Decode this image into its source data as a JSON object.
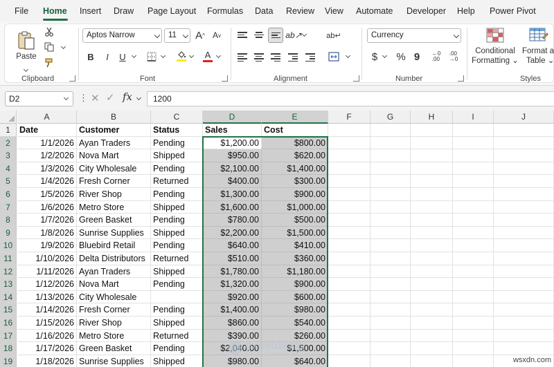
{
  "menu": {
    "tabs": [
      "File",
      "Home",
      "Insert",
      "Draw",
      "Page Layout",
      "Formulas",
      "Data",
      "Review",
      "View",
      "Automate",
      "Developer",
      "Help",
      "Power Pivot"
    ],
    "active": "Home"
  },
  "ribbon": {
    "clipboard": {
      "paste_label": "Paste",
      "group_label": "Clipboard"
    },
    "font": {
      "font_name": "Aptos Narrow",
      "font_size": "11",
      "bold": "B",
      "italic": "I",
      "underline": "U",
      "font_color_glyph": "A",
      "fill_color": "#ffe900",
      "font_color": "#e02020",
      "grow_glyph": "A",
      "shrink_glyph": "A",
      "group_label": "Font"
    },
    "alignment": {
      "group_label": "Alignment"
    },
    "number": {
      "format": "Currency",
      "currency_glyph": "$",
      "percent_glyph": "%",
      "comma_glyph": "9",
      "group_label": "Number"
    },
    "styles": {
      "conditional_formatting_line1": "Conditional",
      "conditional_formatting_line2": "Formatting",
      "format_as_table_line1": "Format as",
      "format_as_table_line2": "Table",
      "group_label": "Styles"
    }
  },
  "formula_bar": {
    "name_box": "D2",
    "fx_label": "fx",
    "value": "1200"
  },
  "sheet": {
    "columns": [
      "A",
      "B",
      "C",
      "D",
      "E",
      "F",
      "G",
      "H",
      "I",
      "J"
    ],
    "selected_columns": [
      "D",
      "E"
    ],
    "selected_range": "D2:E19",
    "active_cell": "D2",
    "headers": [
      "Date",
      "Customer",
      "Status",
      "Sales",
      "Cost"
    ],
    "rows": [
      [
        "1/1/2026",
        "Ayan Traders",
        "Pending",
        "$1,200.00",
        "$800.00"
      ],
      [
        "1/2/2026",
        "Nova Mart",
        "Shipped",
        "$950.00",
        "$620.00"
      ],
      [
        "1/3/2026",
        "City Wholesale",
        "Pending",
        "$2,100.00",
        "$1,400.00"
      ],
      [
        "1/4/2026",
        "Fresh Corner",
        "Returned",
        "$400.00",
        "$300.00"
      ],
      [
        "1/5/2026",
        "River Shop",
        "Pending",
        "$1,300.00",
        "$900.00"
      ],
      [
        "1/6/2026",
        "Metro Store",
        "Shipped",
        "$1,600.00",
        "$1,000.00"
      ],
      [
        "1/7/2026",
        "Green Basket",
        "Pending",
        "$780.00",
        "$500.00"
      ],
      [
        "1/8/2026",
        "Sunrise Supplies",
        "Shipped",
        "$2,200.00",
        "$1,500.00"
      ],
      [
        "1/9/2026",
        "Bluebird Retail",
        "Pending",
        "$640.00",
        "$410.00"
      ],
      [
        "1/10/2026",
        "Delta Distributors",
        "Returned",
        "$510.00",
        "$360.00"
      ],
      [
        "1/11/2026",
        "Ayan Traders",
        "Shipped",
        "$1,780.00",
        "$1,180.00"
      ],
      [
        "1/12/2026",
        "Nova Mart",
        "Pending",
        "$1,320.00",
        "$900.00"
      ],
      [
        "1/13/2026",
        "City Wholesale",
        "",
        "$920.00",
        "$600.00"
      ],
      [
        "1/14/2026",
        "Fresh Corner",
        "Pending",
        "$1,400.00",
        "$980.00"
      ],
      [
        "1/15/2026",
        "River Shop",
        "Shipped",
        "$860.00",
        "$540.00"
      ],
      [
        "1/16/2026",
        "Metro Store",
        "Returned",
        "$390.00",
        "$260.00"
      ],
      [
        "1/17/2026",
        "Green Basket",
        "Pending",
        "$2,040.00",
        "$1,500.00"
      ],
      [
        "1/18/2026",
        "Sunrise Supplies",
        "Shipped",
        "$980.00",
        "$640.00"
      ]
    ]
  },
  "watermark": {
    "name": "exceldemy",
    "tagline": "EXCEL · DATA · BI"
  },
  "site_mark": "wsxdn.com",
  "colors": {
    "accent": "#217346",
    "selection_fill": "#cfcfcf"
  }
}
